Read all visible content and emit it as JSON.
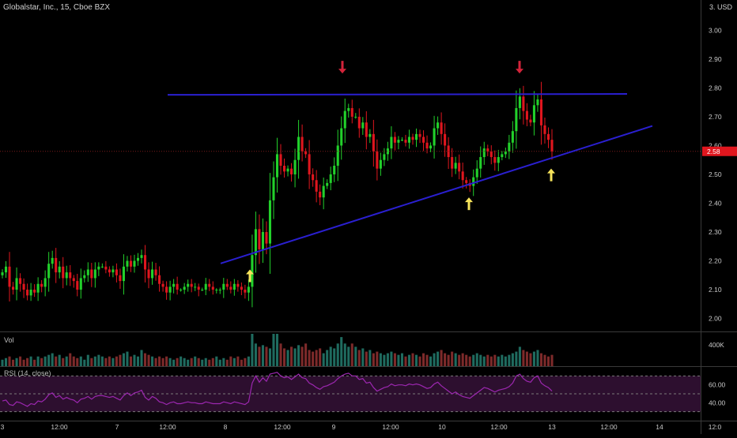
{
  "header": {
    "symbol_line": "Globalstar, Inc., 15, Cboe BZX",
    "currency": "3.  USD"
  },
  "colors": {
    "up": "#22d12b",
    "down": "#e0161e",
    "trendline": "#2a1fd0",
    "arrow_down": "#d3233a",
    "arrow_up": "#f6e35b",
    "price_tag": "#e0161e",
    "rsi_line": "#9c27b0",
    "rsi_band": "#2d0f2f"
  },
  "panes": {
    "volume_label": "Vol",
    "volume_axis_label": "400K",
    "rsi_label": "RSI (14, close)",
    "rsi_axis_labels": [
      "60.00",
      "40.00"
    ]
  },
  "chart_data": {
    "type": "candlestick",
    "price_axis": {
      "ylim": [
        1.955,
        3.105
      ],
      "ticks": [
        "3.00",
        "2.90",
        "2.80",
        "2.70",
        "2.60",
        "2.50",
        "2.40",
        "2.30",
        "2.20",
        "2.10",
        "2.00"
      ],
      "tick_values": [
        3.0,
        2.9,
        2.8,
        2.7,
        2.6,
        2.5,
        2.4,
        2.3,
        2.2,
        2.1,
        2.0
      ]
    },
    "last_price": {
      "label": "2.58",
      "value": 2.58
    },
    "x_axis_ticks": [
      "3",
      "12:00",
      "7",
      "12:00",
      "8",
      "12:00",
      "9",
      "12:00",
      "10",
      "12:00",
      "13",
      "12:00",
      "14",
      "12:0"
    ],
    "x_axis_tick_index": [
      3,
      75,
      148,
      212,
      285,
      357,
      422,
      494,
      559,
      631,
      698,
      770,
      834,
      904
    ],
    "candles_close": [
      2.16,
      2.18,
      2.11,
      2.1,
      2.14,
      2.12,
      2.1,
      2.08,
      2.1,
      2.09,
      2.12,
      2.11,
      2.14,
      2.19,
      2.21,
      2.16,
      2.18,
      2.14,
      2.16,
      2.14,
      2.13,
      2.1,
      2.14,
      2.15,
      2.17,
      2.14,
      2.17,
      2.18,
      2.18,
      2.17,
      2.16,
      2.17,
      2.15,
      2.13,
      2.18,
      2.2,
      2.18,
      2.2,
      2.21,
      2.22,
      2.17,
      2.14,
      2.17,
      2.15,
      2.12,
      2.11,
      2.09,
      2.11,
      2.12,
      2.1,
      2.1,
      2.11,
      2.12,
      2.11,
      2.11,
      2.1,
      2.1,
      2.12,
      2.11,
      2.1,
      2.1,
      2.1,
      2.12,
      2.11,
      2.1,
      2.12,
      2.11,
      2.1,
      2.09,
      2.11,
      2.22,
      2.31,
      2.24,
      2.3,
      2.26,
      2.41,
      2.49,
      2.57,
      2.53,
      2.51,
      2.52,
      2.5,
      2.55,
      2.63,
      2.58,
      2.57,
      2.5,
      2.48,
      2.44,
      2.42,
      2.46,
      2.47,
      2.5,
      2.53,
      2.6,
      2.66,
      2.72,
      2.73,
      2.7,
      2.7,
      2.66,
      2.68,
      2.63,
      2.64,
      2.58,
      2.52,
      2.55,
      2.57,
      2.59,
      2.63,
      2.61,
      2.62,
      2.62,
      2.61,
      2.63,
      2.62,
      2.64,
      2.63,
      2.61,
      2.59,
      2.6,
      2.66,
      2.68,
      2.64,
      2.6,
      2.56,
      2.52,
      2.54,
      2.51,
      2.48,
      2.47,
      2.46,
      2.49,
      2.52,
      2.56,
      2.59,
      2.58,
      2.56,
      2.54,
      2.56,
      2.57,
      2.58,
      2.61,
      2.65,
      2.73,
      2.77,
      2.72,
      2.69,
      2.68,
      2.74,
      2.76,
      2.67,
      2.64,
      2.62,
      2.58
    ],
    "volume_note": "relative bar heights",
    "volume_relative": [
      0.2,
      0.25,
      0.3,
      0.2,
      0.25,
      0.3,
      0.2,
      0.25,
      0.3,
      0.2,
      0.3,
      0.25,
      0.3,
      0.35,
      0.4,
      0.3,
      0.35,
      0.25,
      0.3,
      0.4,
      0.3,
      0.25,
      0.3,
      0.2,
      0.35,
      0.25,
      0.3,
      0.35,
      0.3,
      0.25,
      0.3,
      0.25,
      0.3,
      0.35,
      0.4,
      0.45,
      0.3,
      0.35,
      0.3,
      0.5,
      0.4,
      0.35,
      0.3,
      0.25,
      0.3,
      0.25,
      0.3,
      0.25,
      0.2,
      0.25,
      0.3,
      0.25,
      0.2,
      0.25,
      0.3,
      0.25,
      0.2,
      0.25,
      0.2,
      0.25,
      0.3,
      0.2,
      0.25,
      0.2,
      0.3,
      0.25,
      0.3,
      0.2,
      0.25,
      0.3,
      1.0,
      0.7,
      0.6,
      0.65,
      0.6,
      0.55,
      1.0,
      1.0,
      0.7,
      0.55,
      0.5,
      0.6,
      0.55,
      0.65,
      0.6,
      0.7,
      0.5,
      0.45,
      0.5,
      0.55,
      0.4,
      0.5,
      0.6,
      0.55,
      0.7,
      0.9,
      0.7,
      0.6,
      0.7,
      0.6,
      0.5,
      0.55,
      0.45,
      0.5,
      0.4,
      0.45,
      0.4,
      0.35,
      0.4,
      0.45,
      0.4,
      0.35,
      0.4,
      0.3,
      0.35,
      0.4,
      0.35,
      0.3,
      0.4,
      0.35,
      0.3,
      0.4,
      0.45,
      0.5,
      0.4,
      0.35,
      0.45,
      0.4,
      0.35,
      0.4,
      0.35,
      0.3,
      0.35,
      0.4,
      0.35,
      0.3,
      0.35,
      0.3,
      0.35,
      0.3,
      0.35,
      0.3,
      0.35,
      0.4,
      0.45,
      0.6,
      0.5,
      0.45,
      0.4,
      0.45,
      0.5,
      0.4,
      0.35,
      0.3,
      0.35
    ],
    "rsi": {
      "ylim": [
        20,
        80
      ],
      "band": [
        30,
        70
      ],
      "mid": 50,
      "values": [
        42,
        43,
        38,
        37,
        41,
        40,
        38,
        36,
        39,
        38,
        42,
        41,
        44,
        49,
        51,
        46,
        48,
        44,
        46,
        44,
        43,
        40,
        44,
        45,
        47,
        44,
        47,
        48,
        48,
        47,
        46,
        47,
        45,
        43,
        48,
        51,
        48,
        51,
        52,
        54,
        46,
        43,
        47,
        45,
        41,
        40,
        38,
        40,
        41,
        39,
        39,
        40,
        41,
        40,
        40,
        39,
        39,
        41,
        40,
        39,
        39,
        39,
        41,
        40,
        39,
        41,
        40,
        39,
        38,
        41,
        62,
        70,
        63,
        68,
        64,
        72,
        73,
        74,
        70,
        68,
        69,
        66,
        69,
        72,
        68,
        67,
        62,
        60,
        57,
        55,
        58,
        59,
        61,
        63,
        67,
        70,
        72,
        73,
        70,
        70,
        66,
        67,
        62,
        63,
        57,
        53,
        55,
        57,
        58,
        61,
        59,
        60,
        60,
        59,
        61,
        60,
        61,
        60,
        58,
        56,
        57,
        61,
        63,
        59,
        56,
        53,
        50,
        52,
        49,
        47,
        46,
        45,
        48,
        51,
        54,
        57,
        56,
        54,
        52,
        54,
        55,
        56,
        58,
        62,
        70,
        72,
        67,
        64,
        63,
        68,
        70,
        62,
        59,
        57,
        53
      ]
    },
    "trendlines": [
      {
        "name": "resistance",
        "from": {
          "index": 212,
          "price": 2.776
        },
        "to": {
          "index": 793,
          "price": 2.779
        }
      },
      {
        "name": "support",
        "from": {
          "index": 279,
          "price": 2.191
        },
        "to": {
          "index": 825,
          "price": 2.668
        }
      }
    ],
    "markers": [
      {
        "type": "down-arrow",
        "index": 433,
        "price": 2.85
      },
      {
        "type": "down-arrow",
        "index": 657,
        "price": 2.85
      },
      {
        "type": "up-arrow",
        "index": 316,
        "price": 2.17
      },
      {
        "type": "up-arrow",
        "index": 593,
        "price": 2.42
      },
      {
        "type": "up-arrow",
        "index": 697,
        "price": 2.52
      }
    ]
  }
}
